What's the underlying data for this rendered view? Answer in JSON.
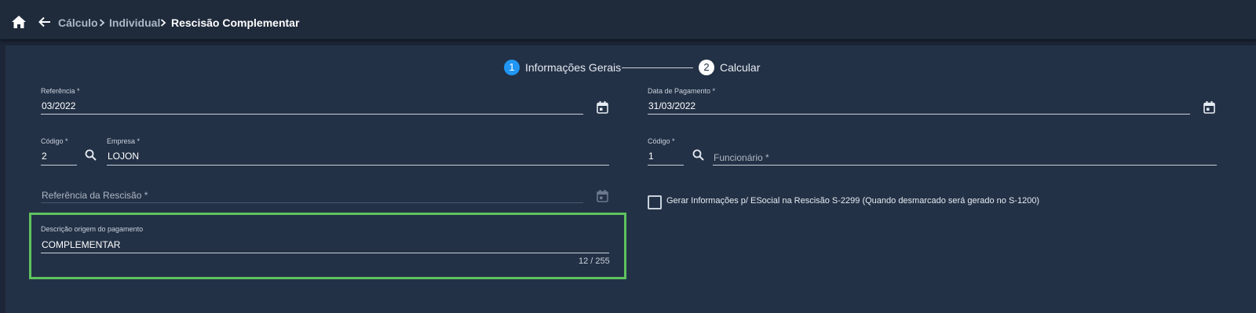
{
  "breadcrumb": {
    "items": [
      "Cálculo",
      "Individual",
      "Rescisão Complementar"
    ]
  },
  "stepper": {
    "steps": [
      {
        "number": "1",
        "label": "Informações Gerais"
      },
      {
        "number": "2",
        "label": "Calcular"
      }
    ]
  },
  "form": {
    "referencia": {
      "label": "Referência *",
      "value": "03/2022"
    },
    "data_pagamento": {
      "label": "Data de Pagamento *",
      "value": "31/03/2022"
    },
    "codigo_empresa": {
      "label": "Código *",
      "value": "2"
    },
    "empresa": {
      "label": "Empresa *",
      "value": "LOJON"
    },
    "codigo_funcionario": {
      "label": "Código *",
      "value": "1"
    },
    "funcionario": {
      "placeholder": "Funcionário *"
    },
    "referencia_rescisao": {
      "placeholder": "Referência da Rescisão *"
    },
    "esocial_checkbox": {
      "label": "Gerar Informações p/ ESocial na Rescisão S-2299 (Quando desmarcado será gerado no S-1200)"
    },
    "descricao": {
      "label": "Descrição origem do pagamento",
      "value": "COMPLEMENTAR",
      "counter": "12 / 255"
    }
  },
  "colors": {
    "background": "#1c2636",
    "panel": "#233146",
    "accent": "#2196f3",
    "highlight": "#5fc25f"
  }
}
